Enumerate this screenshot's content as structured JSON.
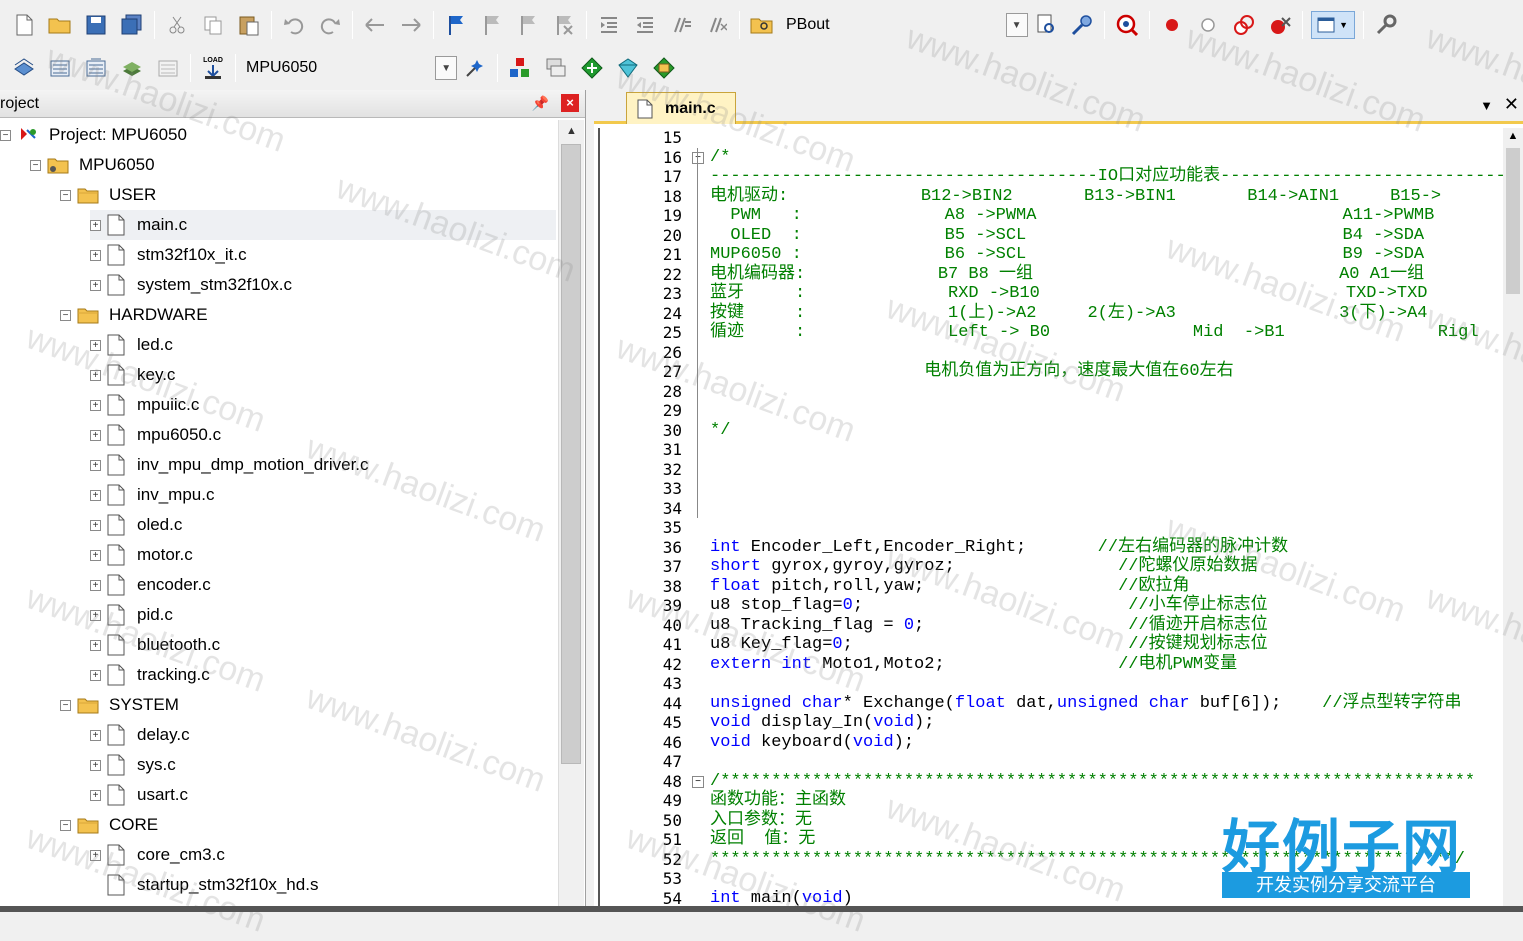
{
  "toolbar1": {
    "target_label": "PBout"
  },
  "toolbar2": {
    "target_combo": "MPU6050",
    "load_label": "LOAD"
  },
  "project_panel": {
    "title": "roject",
    "items": [
      {
        "label": "Project: MPU6050",
        "kind": "project",
        "level": 0,
        "sign": "−"
      },
      {
        "label": "MPU6050",
        "kind": "target",
        "level": 1,
        "sign": "−"
      },
      {
        "label": "USER",
        "kind": "folder",
        "level": 2,
        "sign": "−"
      },
      {
        "label": "main.c",
        "kind": "file",
        "level": 3,
        "sign": "+"
      },
      {
        "label": "stm32f10x_it.c",
        "kind": "file",
        "level": 3,
        "sign": "+"
      },
      {
        "label": "system_stm32f10x.c",
        "kind": "file",
        "level": 3,
        "sign": "+"
      },
      {
        "label": "HARDWARE",
        "kind": "folder",
        "level": 2,
        "sign": "−"
      },
      {
        "label": "led.c",
        "kind": "file",
        "level": 3,
        "sign": "+"
      },
      {
        "label": "key.c",
        "kind": "file",
        "level": 3,
        "sign": "+"
      },
      {
        "label": "mpuiic.c",
        "kind": "file",
        "level": 3,
        "sign": "+"
      },
      {
        "label": "mpu6050.c",
        "kind": "file",
        "level": 3,
        "sign": "+"
      },
      {
        "label": "inv_mpu_dmp_motion_driver.c",
        "kind": "file",
        "level": 3,
        "sign": "+"
      },
      {
        "label": "inv_mpu.c",
        "kind": "file",
        "level": 3,
        "sign": "+"
      },
      {
        "label": "oled.c",
        "kind": "file",
        "level": 3,
        "sign": "+"
      },
      {
        "label": "motor.c",
        "kind": "file",
        "level": 3,
        "sign": "+"
      },
      {
        "label": "encoder.c",
        "kind": "file",
        "level": 3,
        "sign": "+"
      },
      {
        "label": "pid.c",
        "kind": "file",
        "level": 3,
        "sign": "+"
      },
      {
        "label": "bluetooth.c",
        "kind": "file",
        "level": 3,
        "sign": "+"
      },
      {
        "label": "tracking.c",
        "kind": "file",
        "level": 3,
        "sign": "+"
      },
      {
        "label": "SYSTEM",
        "kind": "folder",
        "level": 2,
        "sign": "−"
      },
      {
        "label": "delay.c",
        "kind": "file",
        "level": 3,
        "sign": "+"
      },
      {
        "label": "sys.c",
        "kind": "file",
        "level": 3,
        "sign": "+"
      },
      {
        "label": "usart.c",
        "kind": "file",
        "level": 3,
        "sign": "+"
      },
      {
        "label": "CORE",
        "kind": "folder",
        "level": 2,
        "sign": "−"
      },
      {
        "label": "core_cm3.c",
        "kind": "file",
        "level": 3,
        "sign": "+"
      },
      {
        "label": "startup_stm32f10x_hd.s",
        "kind": "file",
        "level": 3,
        "sign": ""
      }
    ]
  },
  "editor": {
    "active_tab": "main.c",
    "lines": [
      {
        "n": "15",
        "segs": [
          {
            "t": ""
          }
        ]
      },
      {
        "n": "16",
        "fold": "−",
        "segs": [
          {
            "t": "/*",
            "c": "g"
          }
        ]
      },
      {
        "n": "17",
        "segs": [
          {
            "t": "--------------------------------------IO口对应功能表------------------------------",
            "c": "g"
          }
        ]
      },
      {
        "n": "18",
        "segs": [
          {
            "t": "电机驱动:             B12->BIN2       B13->BIN1       B14->AIN1     B15->",
            "c": "g"
          }
        ]
      },
      {
        "n": "19",
        "segs": [
          {
            "t": "  PWM   :              A8 ->PWMA                              A11->PWMB",
            "c": "g"
          }
        ]
      },
      {
        "n": "20",
        "segs": [
          {
            "t": "  OLED  :              B5 ->SCL                               B4 ->SDA",
            "c": "g"
          }
        ]
      },
      {
        "n": "21",
        "segs": [
          {
            "t": "MUP6050 :              B6 ->SCL                               B9 ->SDA",
            "c": "g"
          }
        ]
      },
      {
        "n": "22",
        "segs": [
          {
            "t": "电机编码器:             B7 B8 一组                              A0 A1一组",
            "c": "g"
          }
        ]
      },
      {
        "n": "23",
        "segs": [
          {
            "t": "蓝牙     :              RXD ->B10                              TXD->TXD",
            "c": "g"
          }
        ]
      },
      {
        "n": "24",
        "segs": [
          {
            "t": "按键     :              1(上)->A2     2(左)->A3                3(下)->A4",
            "c": "g"
          }
        ]
      },
      {
        "n": "25",
        "segs": [
          {
            "t": "循迹     :              Left -> B0              Mid  ->B1               Rigl",
            "c": "g"
          }
        ]
      },
      {
        "n": "26",
        "segs": [
          {
            "t": ""
          }
        ]
      },
      {
        "n": "27",
        "segs": [
          {
            "t": "                     电机负值为正方向，速度最大值在60左右",
            "c": "g"
          }
        ]
      },
      {
        "n": "28",
        "segs": [
          {
            "t": ""
          }
        ]
      },
      {
        "n": "29",
        "segs": [
          {
            "t": ""
          }
        ]
      },
      {
        "n": "30",
        "segs": [
          {
            "t": "*/",
            "c": "g"
          }
        ]
      },
      {
        "n": "31",
        "segs": [
          {
            "t": ""
          }
        ]
      },
      {
        "n": "32",
        "segs": [
          {
            "t": ""
          }
        ]
      },
      {
        "n": "33",
        "segs": [
          {
            "t": ""
          }
        ]
      },
      {
        "n": "34",
        "segs": [
          {
            "t": ""
          }
        ]
      },
      {
        "n": "35",
        "segs": [
          {
            "t": ""
          }
        ]
      },
      {
        "n": "36",
        "segs": [
          {
            "t": "int",
            "c": "kw"
          },
          {
            "t": " Encoder_Left,Encoder_Right;       "
          },
          {
            "t": "//左右编码器的脉冲计数",
            "c": "g"
          }
        ]
      },
      {
        "n": "37",
        "segs": [
          {
            "t": "short",
            "c": "kw"
          },
          {
            "t": " gyrox,gyroy,gyroz;                "
          },
          {
            "t": "//陀螺仪原始数据",
            "c": "g"
          }
        ]
      },
      {
        "n": "38",
        "segs": [
          {
            "t": "float",
            "c": "kw"
          },
          {
            "t": " pitch,roll,yaw;                   "
          },
          {
            "t": "//欧拉角",
            "c": "g"
          }
        ]
      },
      {
        "n": "39",
        "segs": [
          {
            "t": "u8 stop_flag="
          },
          {
            "t": "0",
            "c": "kw"
          },
          {
            "t": ";                          "
          },
          {
            "t": "//小车停止标志位",
            "c": "g"
          }
        ]
      },
      {
        "n": "40",
        "segs": [
          {
            "t": "u8 Tracking_flag = "
          },
          {
            "t": "0",
            "c": "kw"
          },
          {
            "t": ";                    "
          },
          {
            "t": "//循迹开启标志位",
            "c": "g"
          }
        ]
      },
      {
        "n": "41",
        "segs": [
          {
            "t": "u8 Key_flag="
          },
          {
            "t": "0",
            "c": "kw"
          },
          {
            "t": ";                           "
          },
          {
            "t": "//按键规划标志位",
            "c": "g"
          }
        ]
      },
      {
        "n": "42",
        "segs": [
          {
            "t": "extern",
            "c": "kw"
          },
          {
            "t": " "
          },
          {
            "t": "int",
            "c": "kw"
          },
          {
            "t": " Moto1,Moto2;                 "
          },
          {
            "t": "//电机PWM变量",
            "c": "g"
          }
        ]
      },
      {
        "n": "43",
        "segs": [
          {
            "t": ""
          }
        ]
      },
      {
        "n": "44",
        "segs": [
          {
            "t": "unsigned",
            "c": "kw"
          },
          {
            "t": " "
          },
          {
            "t": "char",
            "c": "kw"
          },
          {
            "t": "* Exchange("
          },
          {
            "t": "float",
            "c": "kw"
          },
          {
            "t": " dat,"
          },
          {
            "t": "unsigned",
            "c": "kw"
          },
          {
            "t": " "
          },
          {
            "t": "char",
            "c": "kw"
          },
          {
            "t": " buf[6]);    "
          },
          {
            "t": "//浮点型转字符串",
            "c": "g"
          }
        ]
      },
      {
        "n": "45",
        "segs": [
          {
            "t": "void",
            "c": "kw"
          },
          {
            "t": " display_In("
          },
          {
            "t": "void",
            "c": "kw"
          },
          {
            "t": ");"
          }
        ]
      },
      {
        "n": "46",
        "segs": [
          {
            "t": "void",
            "c": "kw"
          },
          {
            "t": " keyboard("
          },
          {
            "t": "void",
            "c": "kw"
          },
          {
            "t": ");"
          }
        ]
      },
      {
        "n": "47",
        "segs": [
          {
            "t": ""
          }
        ]
      },
      {
        "n": "48",
        "fold": "−",
        "segs": [
          {
            "t": "/**************************************************************************",
            "c": "g"
          }
        ]
      },
      {
        "n": "49",
        "segs": [
          {
            "t": "函数功能：主函数",
            "c": "g"
          }
        ]
      },
      {
        "n": "50",
        "segs": [
          {
            "t": "入口参数：无",
            "c": "g"
          }
        ]
      },
      {
        "n": "51",
        "segs": [
          {
            "t": "返回  值：无",
            "c": "g"
          }
        ]
      },
      {
        "n": "52",
        "segs": [
          {
            "t": "*************************************************************************/",
            "c": "g"
          }
        ]
      },
      {
        "n": "53",
        "segs": [
          {
            "t": ""
          }
        ]
      },
      {
        "n": "54",
        "segs": [
          {
            "t": "int",
            "c": "kw"
          },
          {
            "t": " main("
          },
          {
            "t": "void",
            "c": "kw"
          },
          {
            "t": ")"
          }
        ]
      }
    ]
  },
  "watermark": "www.haolizi.com",
  "logo": {
    "title": "好例子网",
    "subtitle": "开发实例分享交流平台"
  },
  "colors": {
    "comment": "#008000",
    "keyword": "#0000ff",
    "logo": "#1c9be0",
    "tab_accent": "#f2c94c"
  }
}
